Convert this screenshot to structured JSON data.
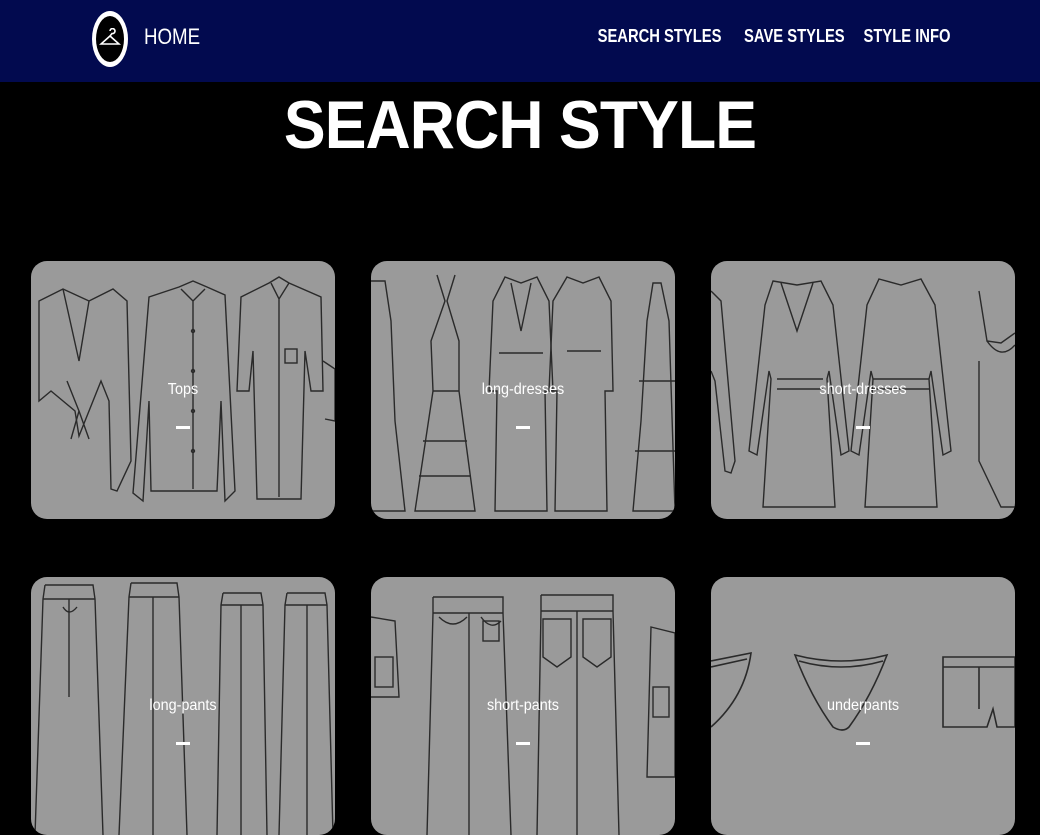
{
  "nav": {
    "logo_icon": "hanger-icon",
    "home_label": "HOME",
    "links": [
      "SEARCH STYLES",
      "SAVE STYLES",
      "STYLE INFO"
    ]
  },
  "page": {
    "title": "SEARCH STYLE"
  },
  "categories": [
    {
      "label": "Tops",
      "icon": "tops-sketch"
    },
    {
      "label": "long-dresses",
      "icon": "long-dresses-sketch"
    },
    {
      "label": "short-dresses",
      "icon": "short-dresses-sketch"
    },
    {
      "label": "long-pants",
      "icon": "long-pants-sketch"
    },
    {
      "label": "short-pants",
      "icon": "short-pants-sketch"
    },
    {
      "label": "underpants",
      "icon": "underpants-sketch"
    }
  ],
  "colors": {
    "navbar": "#020a4f",
    "background": "#000000",
    "card": "#9a9a9a",
    "text": "#ffffff"
  }
}
